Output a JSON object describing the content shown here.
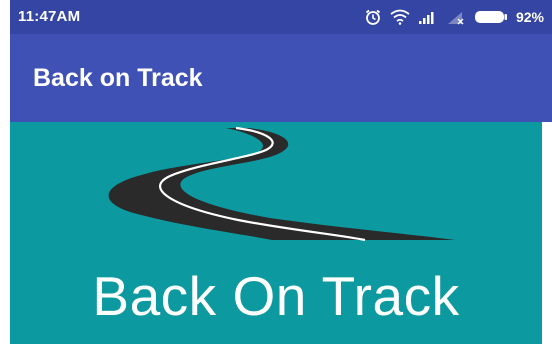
{
  "status_bar": {
    "time": "11:47AM",
    "battery_percent": "92%",
    "icons": [
      "alarm-icon",
      "wifi-icon",
      "signal-icon",
      "no-signal-icon",
      "battery-icon"
    ]
  },
  "app_bar": {
    "title": "Back on Track"
  },
  "splash": {
    "title": "Back On Track",
    "graphic": "road-icon"
  },
  "colors": {
    "status_bar": "#3545a3",
    "app_bar": "#3f51b5",
    "splash_background": "#0c9aa0",
    "road": "#2a2a2a",
    "road_line": "#ffffff"
  }
}
